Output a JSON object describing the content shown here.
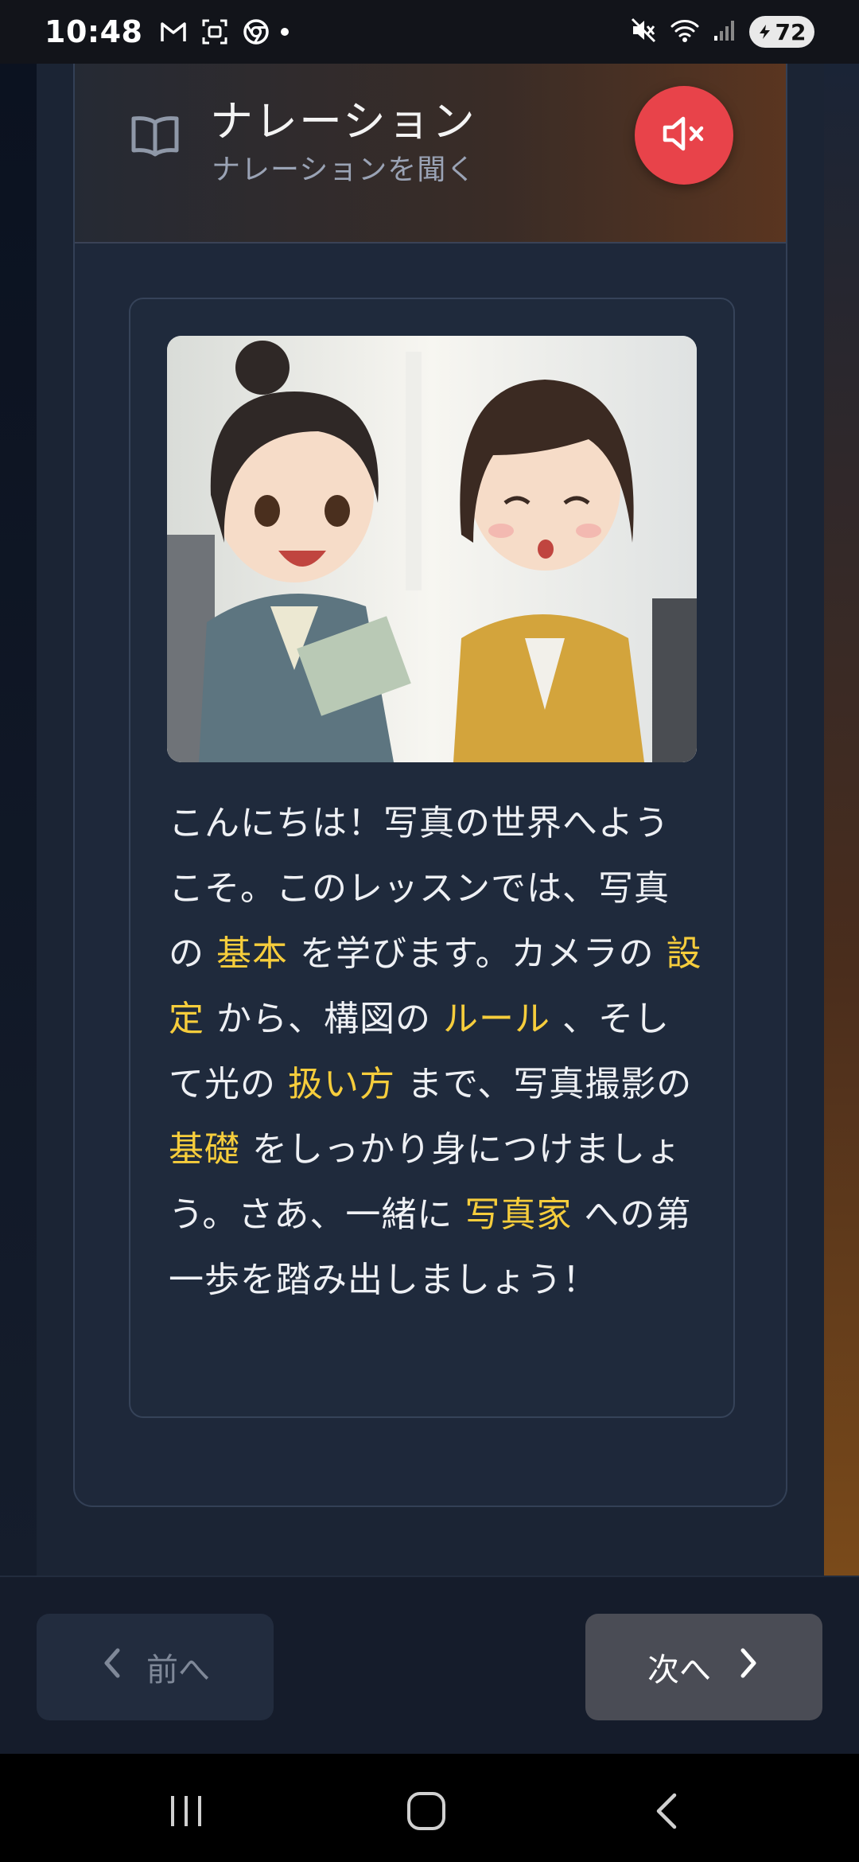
{
  "status_bar": {
    "time": "10:48",
    "battery_level": "72",
    "icons": [
      "gmail-icon",
      "screenshot-icon",
      "chrome-icon",
      "mute-icon",
      "wifi-icon",
      "signal-icon"
    ]
  },
  "header": {
    "title": "ナレーション",
    "subtitle": "ナレーションを聞く",
    "mute_button_state": "muted",
    "icon": "book-open-icon",
    "mute_color": "#e8434a"
  },
  "narration": {
    "illustration": "two-anime-girls-talking-about-a-book",
    "segments": [
      {
        "text": "こんにちは！写真の世界へようこそ。このレッスンでは、写真の ",
        "highlight": false
      },
      {
        "text": "基本",
        "highlight": true
      },
      {
        "text": " を学びます。カメラの ",
        "highlight": false
      },
      {
        "text": "設定",
        "highlight": true
      },
      {
        "text": " から、構図の ",
        "highlight": false
      },
      {
        "text": "ルール",
        "highlight": true
      },
      {
        "text": " 、そして光の ",
        "highlight": false
      },
      {
        "text": "扱い方",
        "highlight": true
      },
      {
        "text": " まで、写真撮影の ",
        "highlight": false
      },
      {
        "text": "基礎",
        "highlight": true
      },
      {
        "text": " をしっかり身につけましょう。さあ、一緒に ",
        "highlight": false
      },
      {
        "text": "写真家",
        "highlight": true
      },
      {
        "text": " への第一歩を踏み出しましょう！",
        "highlight": false
      }
    ],
    "highlight_color": "#f6cd3c"
  },
  "navigation": {
    "prev_label": "前へ",
    "next_label": "次へ"
  }
}
